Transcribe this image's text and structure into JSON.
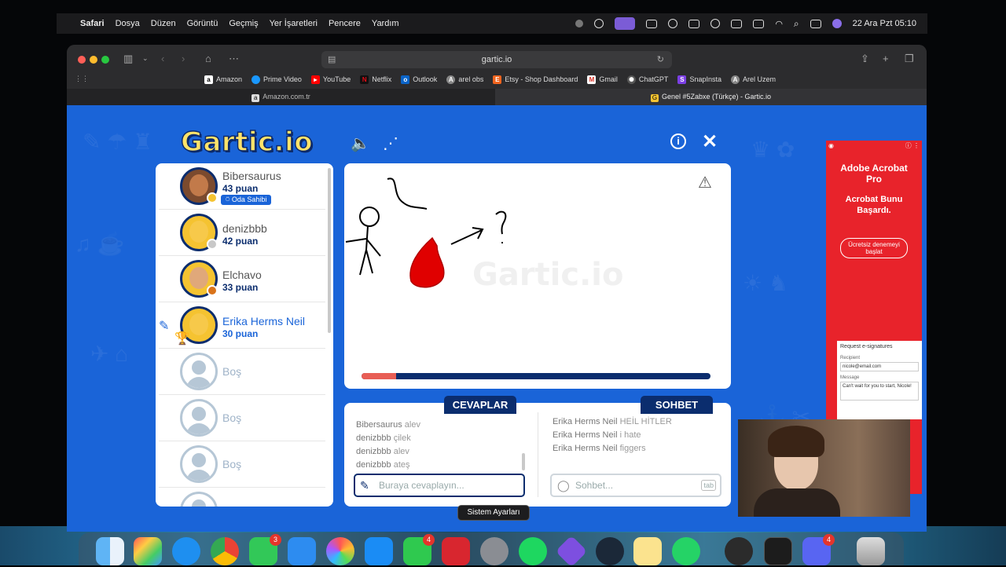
{
  "menubar": {
    "app": "Safari",
    "items": [
      "Dosya",
      "Düzen",
      "Görüntü",
      "Geçmiş",
      "Yer İşaretleri",
      "Pencere",
      "Yardım"
    ],
    "clock": "22 Ara Pzt  05:10"
  },
  "browser": {
    "url": "gartic.io",
    "bookmarks": [
      "Amazon",
      "Prime Video",
      "YouTube",
      "Netflix",
      "Outlook",
      "arel obs",
      "Etsy - Shop Dashboard",
      "Gmail",
      "ChatGPT",
      "SnapInsta",
      "Arel Uzem"
    ],
    "tabs": [
      "Amazon.com.tr",
      "Genel #5Zabxe (Türkçe) - Gartic.io"
    ]
  },
  "game": {
    "logo": "Gartic.io",
    "players": [
      {
        "name": "Bibersaurus",
        "score": "43 puan",
        "badge": "Oda Sahibi",
        "dot": "#f5c331"
      },
      {
        "name": "denizbbb",
        "score": "42 puan",
        "dot": "#c8c8c8"
      },
      {
        "name": "Elchavo",
        "score": "33 puan",
        "dot": "#d9731a"
      },
      {
        "name": "Erika Herms Neil",
        "score": "30 puan"
      }
    ],
    "empty_slot": "Boş",
    "progress": 0.1,
    "answers_tab": "CEVAPLAR",
    "chat_tab": "SOHBET",
    "answers": [
      {
        "user": "Bibersaurus",
        "text": "alev"
      },
      {
        "user": "denizbbb",
        "text": "çilek"
      },
      {
        "user": "denizbbb",
        "text": "alev"
      },
      {
        "user": "denizbbb",
        "text": "ateş"
      }
    ],
    "chat": [
      {
        "user": "Erika Herms Neil",
        "text": "HEİL HİTLER"
      },
      {
        "user": "Erika Herms Neil",
        "text": "i hate"
      },
      {
        "user": "Erika Herms Neil",
        "text": "figgers"
      }
    ],
    "answer_placeholder": "Buraya cevaplayın...",
    "chat_placeholder": "Sohbet...",
    "chat_key_hint": "tab"
  },
  "ad": {
    "title": "Adobe Acrobat Pro",
    "headline": "Acrobat Bunu Başardı.",
    "cta": "Ücretsiz denemeyi başlat",
    "form_title": "Request e-signatures",
    "recipient_label": "Recipient",
    "recipient_value": "nicole@email.com",
    "message_label": "Message",
    "message_value": "Can't wait for you to start, Nicole!"
  },
  "tooltip": "Sistem Ayarları",
  "dock_badges": [
    "3",
    "4",
    "4"
  ]
}
